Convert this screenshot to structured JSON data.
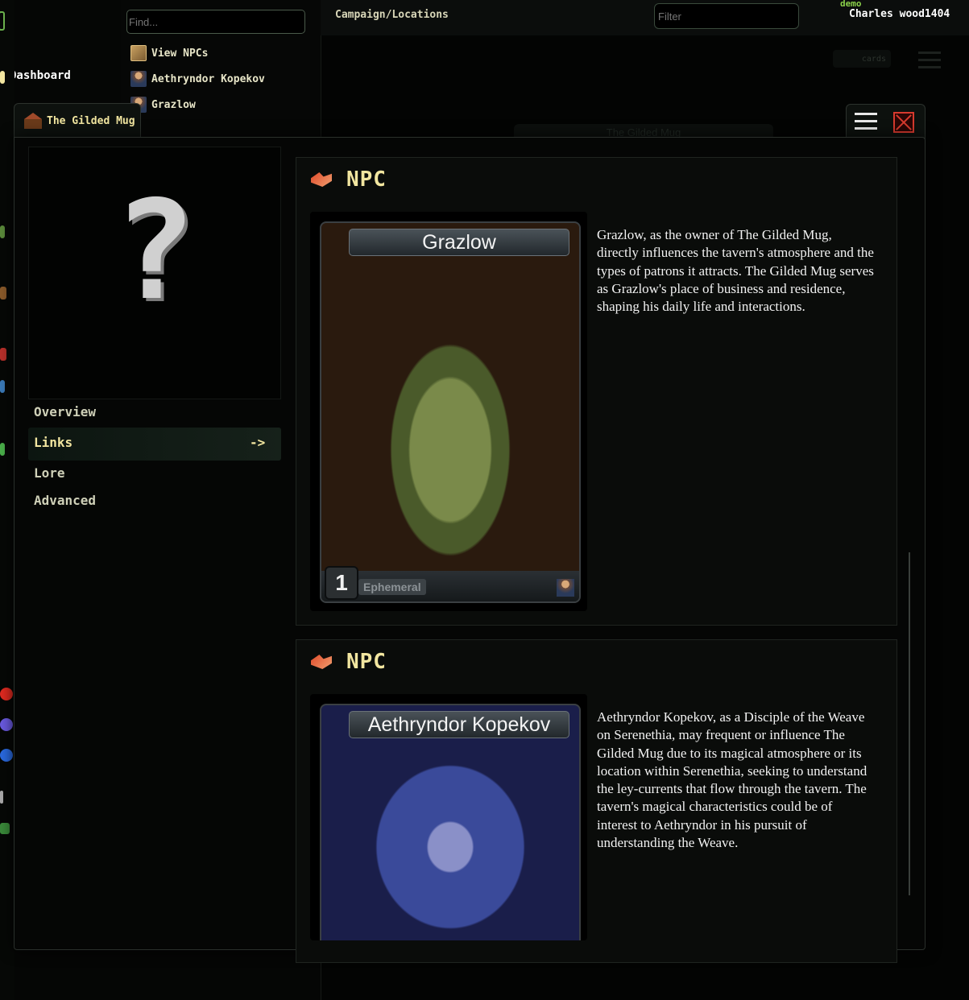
{
  "topbar": {
    "breadcrumb": "Campaign/Locations",
    "filter_placeholder": "Filter",
    "demo_badge": "demo",
    "user_name": "Charles wood1404"
  },
  "search": {
    "placeholder": "Find..."
  },
  "quick_links": [
    {
      "label": "View NPCs",
      "icon": "npc-book-icon"
    },
    {
      "label": "Aethryndor Kopekov",
      "icon": "character-avatar-icon"
    },
    {
      "label": "Grazlow",
      "icon": "character-avatar-icon"
    }
  ],
  "nav": {
    "dashboard_label": "Dashboard"
  },
  "background": {
    "cards_toggle_label": "cards",
    "ghost_tab_label": "The Gilded Mug"
  },
  "modal": {
    "tab_title": "The Gilded Mug",
    "tab_icon": "tavern-icon",
    "portrait_placeholder": "?",
    "menu": {
      "overview": "Overview",
      "links": "Links",
      "lore": "Lore",
      "advanced": "Advanced",
      "active_arrow": "->"
    },
    "links": [
      {
        "type_label": "NPC",
        "card_name": "Grazlow",
        "cost": "1",
        "tag": "Ephemeral",
        "description": "Grazlow, as the owner of The Gilded Mug, directly influences the tavern's atmosphere and the types of patrons it attracts. The Gilded Mug serves as Grazlow's place of business and residence, shaping his daily life and interactions."
      },
      {
        "type_label": "NPC",
        "card_name": "Aethryndor Kopekov",
        "description": "Aethryndor Kopekov, as a Disciple of the Weave on Serenethia, may frequent or influence The Gilded Mug due to its magical atmosphere or its location within Serenethia, seeking to understand the ley-currents that flow through the tavern. The tavern's magical characteristics could be of interest to Aethryndor in his pursuit of understanding the Weave."
      }
    ]
  },
  "colors": {
    "accent_yellow": "#f2e6a0",
    "demo_green": "#8bd14a",
    "close_red": "#d83a2e"
  }
}
